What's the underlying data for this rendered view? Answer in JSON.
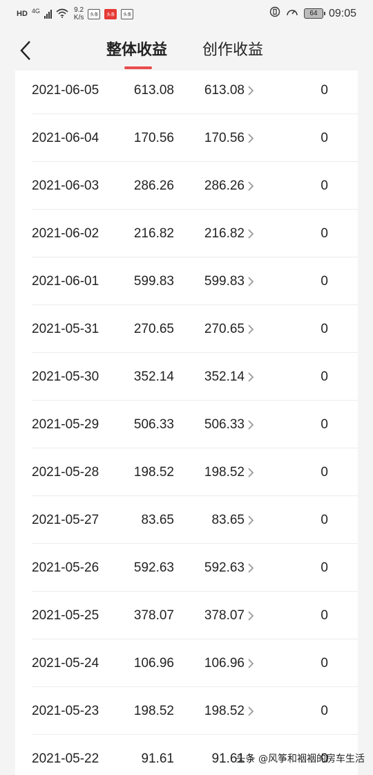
{
  "status_bar": {
    "hd": "HD",
    "network": "4G",
    "speed_value": "9.2",
    "speed_unit": "K/s",
    "battery": "64",
    "time": "09:05",
    "notif_labels": [
      "头条",
      "头条",
      "头条"
    ]
  },
  "nav": {
    "tabs": [
      {
        "label": "整体收益",
        "active": true
      },
      {
        "label": "创作收益",
        "active": false
      }
    ]
  },
  "rows": [
    {
      "date": "2021-06-05",
      "total": "613.08",
      "creation": "613.08",
      "other": "0"
    },
    {
      "date": "2021-06-04",
      "total": "170.56",
      "creation": "170.56",
      "other": "0"
    },
    {
      "date": "2021-06-03",
      "total": "286.26",
      "creation": "286.26",
      "other": "0"
    },
    {
      "date": "2021-06-02",
      "total": "216.82",
      "creation": "216.82",
      "other": "0"
    },
    {
      "date": "2021-06-01",
      "total": "599.83",
      "creation": "599.83",
      "other": "0"
    },
    {
      "date": "2021-05-31",
      "total": "270.65",
      "creation": "270.65",
      "other": "0"
    },
    {
      "date": "2021-05-30",
      "total": "352.14",
      "creation": "352.14",
      "other": "0"
    },
    {
      "date": "2021-05-29",
      "total": "506.33",
      "creation": "506.33",
      "other": "0"
    },
    {
      "date": "2021-05-28",
      "total": "198.52",
      "creation": "198.52",
      "other": "0"
    },
    {
      "date": "2021-05-27",
      "total": "83.65",
      "creation": "83.65",
      "other": "0"
    },
    {
      "date": "2021-05-26",
      "total": "592.63",
      "creation": "592.63",
      "other": "0"
    },
    {
      "date": "2021-05-25",
      "total": "378.07",
      "creation": "378.07",
      "other": "0"
    },
    {
      "date": "2021-05-24",
      "total": "106.96",
      "creation": "106.96",
      "other": "0"
    },
    {
      "date": "2021-05-23",
      "total": "198.52",
      "creation": "198.52",
      "other": "0"
    },
    {
      "date": "2021-05-22",
      "total": "91.61",
      "creation": "91.61",
      "other": "0"
    }
  ],
  "watermark": "头条 @风筝和裀裀的房车生活",
  "colors": {
    "accent": "#e94c4c",
    "background": "#f4f4f4",
    "card": "#ffffff",
    "text": "#222222"
  }
}
